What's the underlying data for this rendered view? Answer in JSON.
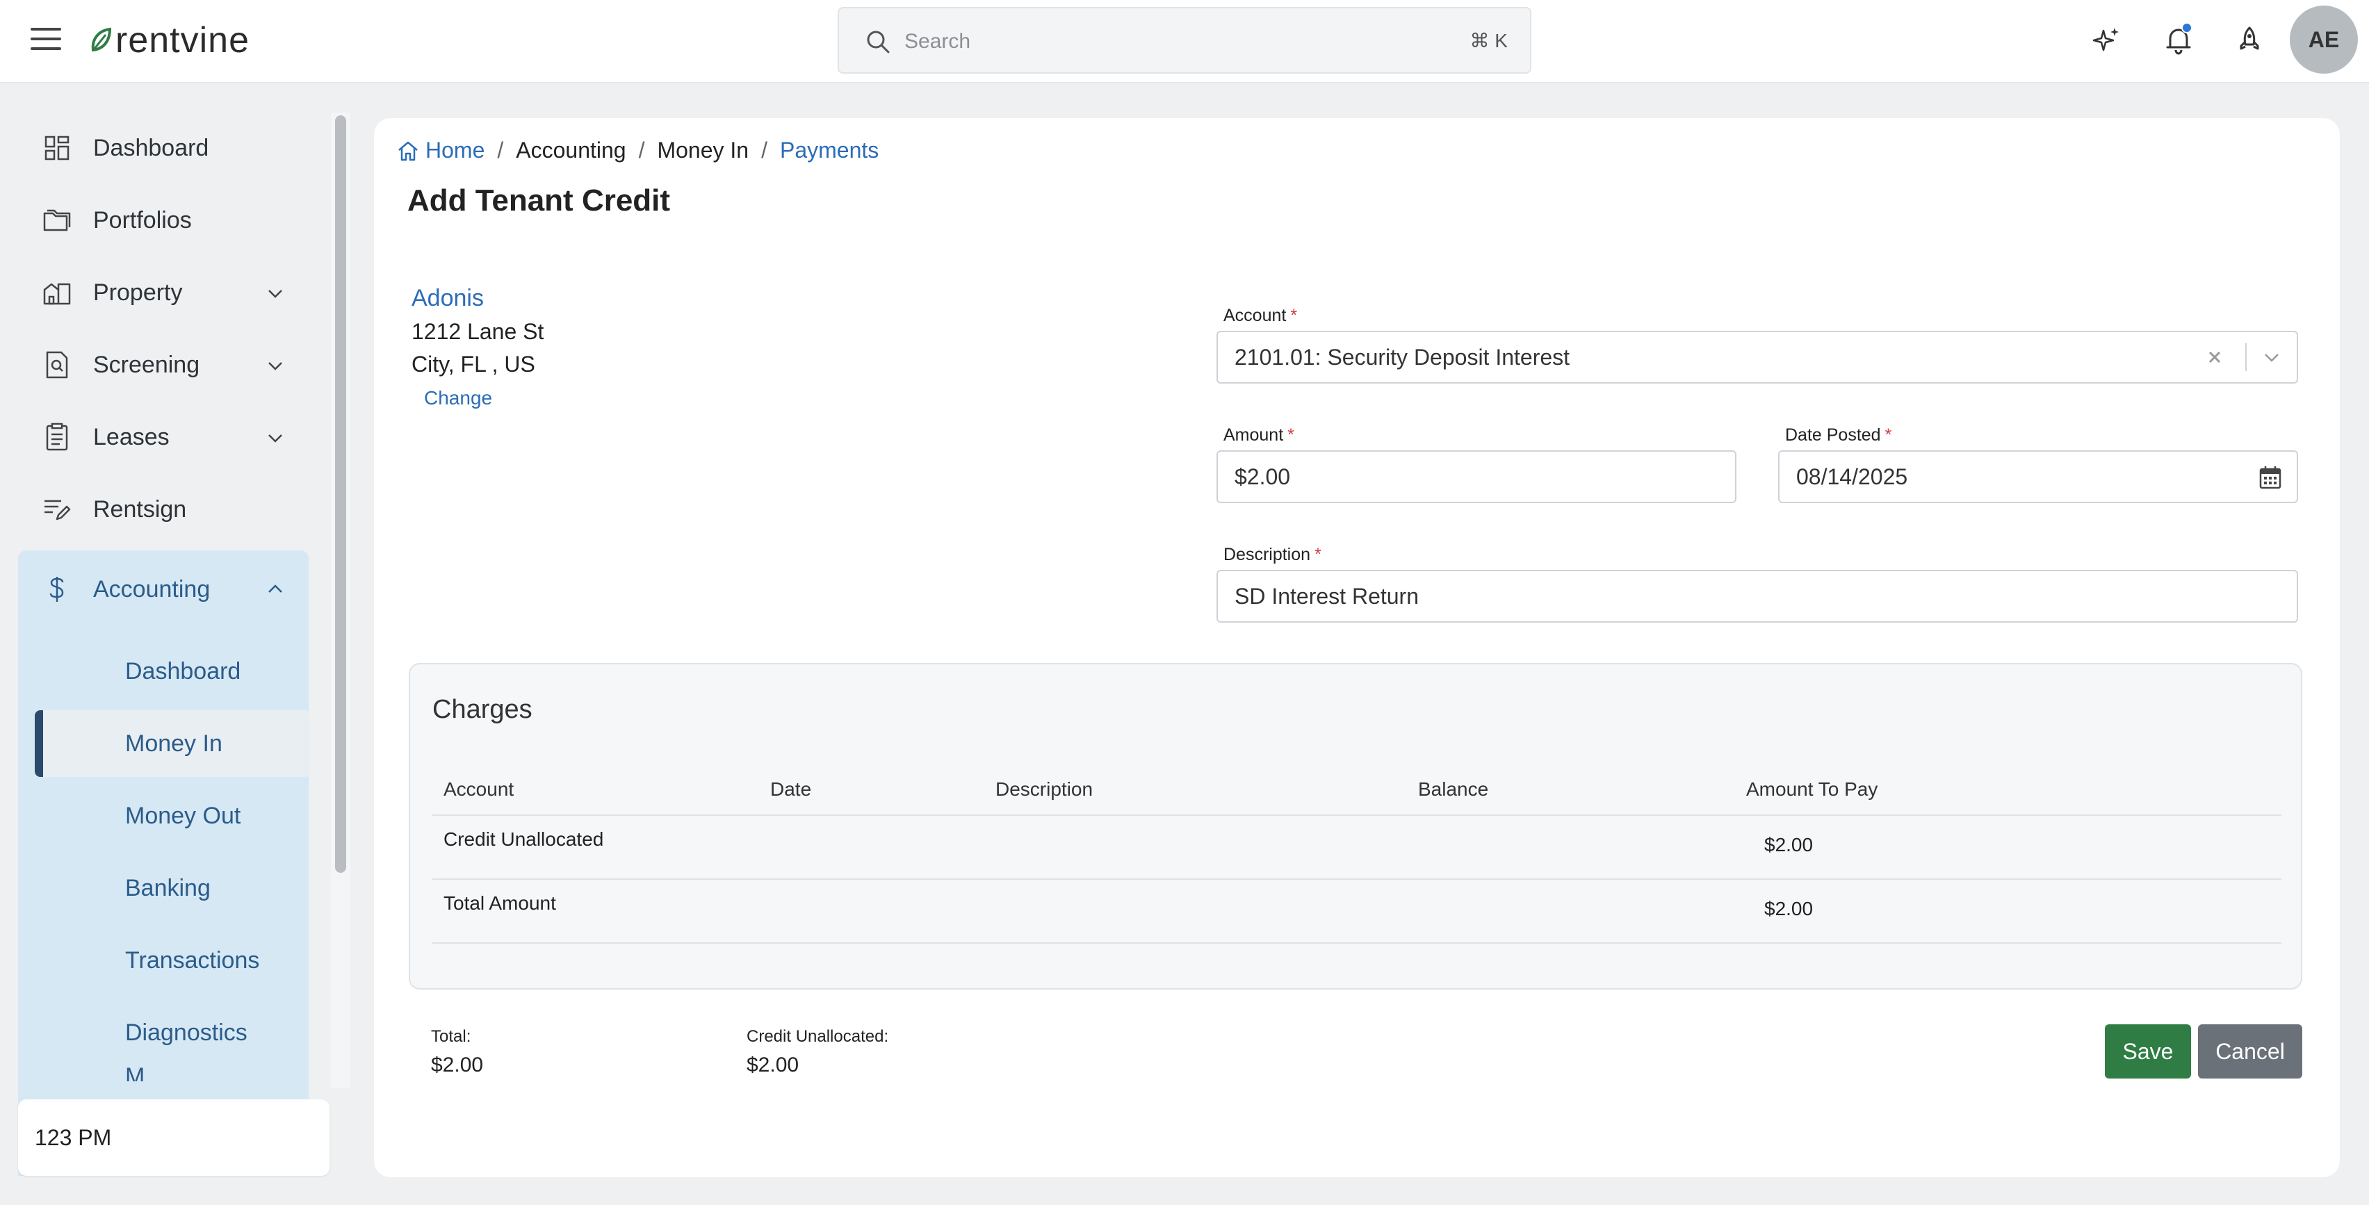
{
  "app": {
    "brand": "rentvine",
    "brand_color": "#2f7d45"
  },
  "topbar": {
    "search_placeholder": "Search",
    "search_shortcut": "⌘ K",
    "avatar_initials": "AE",
    "notification_dot_color": "#2b76d8"
  },
  "sidebar": {
    "items": [
      {
        "label": "Dashboard",
        "icon": "dashboard-icon"
      },
      {
        "label": "Portfolios",
        "icon": "folders-icon"
      },
      {
        "label": "Property",
        "icon": "property-icon",
        "expandable": true
      },
      {
        "label": "Screening",
        "icon": "screening-icon",
        "expandable": true
      },
      {
        "label": "Leases",
        "icon": "leases-icon",
        "expandable": true
      },
      {
        "label": "Rentsign",
        "icon": "rentsign-icon"
      }
    ],
    "accounting": {
      "label": "Accounting",
      "icon": "dollar-icon",
      "expanded": true,
      "sub_items": [
        "Dashboard",
        "Money In",
        "Money Out",
        "Banking",
        "Transactions",
        "Diagnostics",
        "M"
      ],
      "active": "Money In"
    },
    "footer_text": "123 PM"
  },
  "breadcrumb": {
    "home": "Home",
    "accounting": "Accounting",
    "money_in": "Money In",
    "payments": "Payments"
  },
  "page": {
    "title": "Add Tenant Credit"
  },
  "tenant": {
    "name": "Adonis",
    "address_line1": "1212 Lane St",
    "address_line2": "City, FL , US",
    "change_label": "Change"
  },
  "form": {
    "account_label": "Account",
    "account_value": "2101.01: Security Deposit Interest",
    "amount_label": "Amount",
    "amount_value": "$2.00",
    "date_label": "Date Posted",
    "date_value": "08/14/2025",
    "description_label": "Description",
    "description_value": "SD Interest Return",
    "required_mark": "*"
  },
  "charges": {
    "title": "Charges",
    "columns": [
      "Account",
      "Date",
      "Description",
      "Balance",
      "Amount To Pay"
    ],
    "rows": [
      {
        "account": "Credit Unallocated",
        "date": "",
        "description": "",
        "balance": "",
        "amount_to_pay": "$2.00"
      },
      {
        "account": "Total Amount",
        "date": "",
        "description": "",
        "balance": "",
        "amount_to_pay": "$2.00"
      }
    ]
  },
  "summary": {
    "total_label": "Total:",
    "total_value": "$2.00",
    "credit_label": "Credit Unallocated:",
    "credit_value": "$2.00"
  },
  "actions": {
    "save_label": "Save",
    "cancel_label": "Cancel"
  }
}
